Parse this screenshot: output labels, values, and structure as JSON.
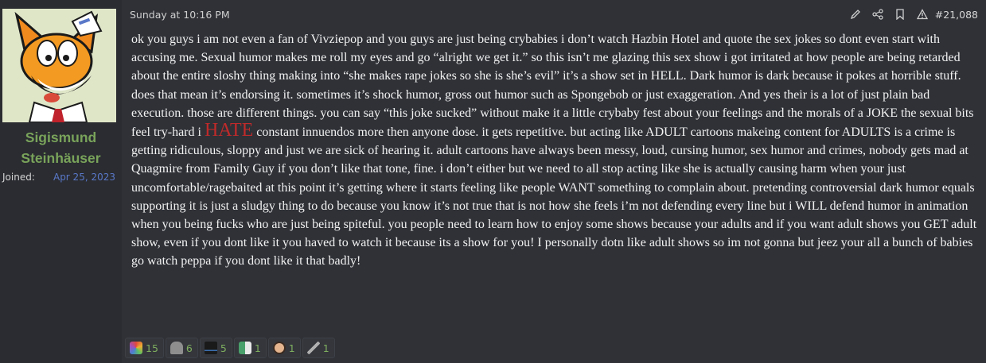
{
  "user": {
    "name_line1": "Sigismund",
    "name_line2": "Steinhäuser",
    "joined_label": "Joined:",
    "joined_date": "Apr 25, 2023",
    "avatar_icon": "cartoon-fox-avatar"
  },
  "post": {
    "date": "Sunday at 10:16 PM",
    "number": "#21,088",
    "actions": [
      "edit-icon",
      "share-icon",
      "bookmark-icon",
      "report-icon"
    ],
    "text_before_hate": "ok you guys i am not even a fan of Vivziepop and you guys are just being crybabies i don’t watch Hazbin Hotel and quote the sex jokes so dont even start with accusing me. Sexual humor makes me roll my eyes and go “alright we get it.” so this isn’t me glazing this sex show i got irritated at how people are being retarded about the entire sloshy thing making into “she makes rape jokes so she is she’s evil” it’s a show set in HELL. Dark humor is dark because it pokes at horrible stuff. does that mean it’s endorsing it. sometimes it’s shock humor, gross out humor such as Spongebob or just exaggeration. And yes their is a lot of just plain bad execution. those are different things. you can say “this joke sucked” without make it a little crybaby fest about your feelings and the morals of a JOKE the sexual bits feel try-hard i ",
    "hate_word": "HATE",
    "text_after_hate": " constant innuendos more then anyone dose. it gets repetitive. but acting like ADULT cartoons makeing content for ADULTS is a crime is getting ridiculous, sloppy and just we are sick of hearing it. adult cartoons have always been messy, loud, cursing humor, sex humor and crimes, nobody gets mad at Quagmire from Family Guy if you don’t like that tone, fine. i don’t either but we need to all stop acting like she is actually causing harm when your just uncomfortable/ragebaited at this point it’s getting where it starts feeling like people WANT something to complain about. pretending controversial dark humor equals supporting it is just a sludgy thing to do because you know it’s not true that is not how she feels i’m not defending every line but i WILL defend humor in animation when you being fucks who are just being spiteful. you people need to learn how to enjoy some shows because your adults and if you want adult shows you GET adult show, even if you dont like it you haved to watch it because its a show for you! I personally dotn like adult shows so im not gonna but jeez your all a bunch of babies go watch peppa if you dont like it that badly!",
    "hate_color": "#c02a2a"
  },
  "reactions": [
    {
      "icon": "rainbow-puzzle-icon",
      "count": "15",
      "color": "#c9a04a"
    },
    {
      "icon": "tombstone-icon",
      "count": "6",
      "color": "#9a9a9a"
    },
    {
      "icon": "top-hat-icon",
      "count": "5",
      "color": "#3a6fb0"
    },
    {
      "icon": "flag-icon",
      "count": "1",
      "color": "#4aa06a"
    },
    {
      "icon": "face-icon",
      "count": "1",
      "color": "#c98a6a"
    },
    {
      "icon": "wand-icon",
      "count": "1",
      "color": "#a0a0a0"
    }
  ]
}
